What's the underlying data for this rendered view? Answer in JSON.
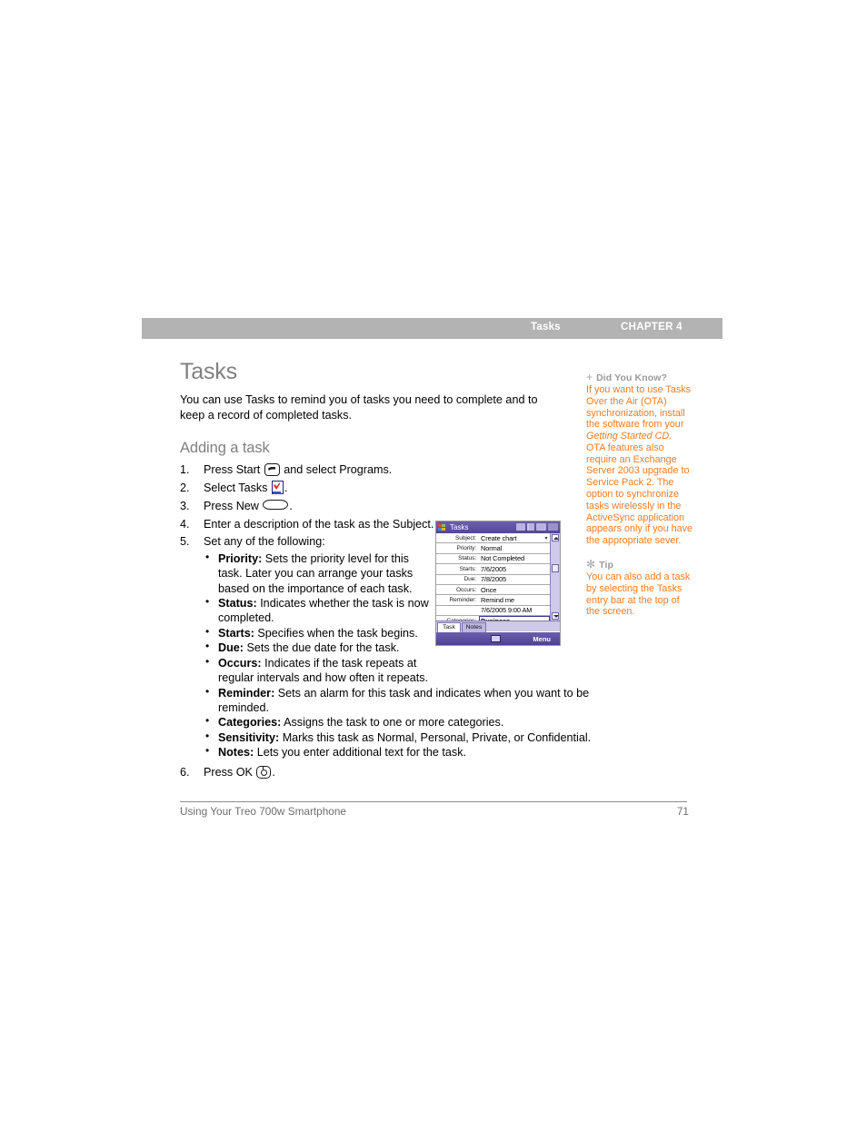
{
  "header": {
    "section": "Tasks",
    "chapter": "CHAPTER 4"
  },
  "main": {
    "title": "Tasks",
    "intro": "You can use Tasks to remind you of tasks you need to complete and to keep a record of completed tasks.",
    "subhead": "Adding a task",
    "steps": [
      {
        "num": "1.",
        "pre": "Press Start",
        "icon": "start-key-icon",
        "post": "and select Programs."
      },
      {
        "num": "2.",
        "pre": "Select Tasks",
        "icon": "tasks-app-icon",
        "post": "."
      },
      {
        "num": "3.",
        "pre": "Press New",
        "icon": "softkey-icon",
        "post": "."
      },
      {
        "num": "4.",
        "pre": "Enter a description of the task as the Subject.",
        "icon": "",
        "post": ""
      },
      {
        "num": "5.",
        "pre": "Set any of the following:",
        "icon": "",
        "post": ""
      },
      {
        "num": "6.",
        "pre": "Press OK",
        "icon": "ok-key-icon",
        "post": "."
      }
    ],
    "bullets": [
      {
        "term": "Priority:",
        "desc": "Sets the priority level for this task. Later you can arrange your tasks based on the importance of each task."
      },
      {
        "term": "Status:",
        "desc": "Indicates whether the task is now completed."
      },
      {
        "term": "Starts:",
        "desc": "Specifies when the task begins."
      },
      {
        "term": "Due:",
        "desc": "Sets the due date for the task."
      },
      {
        "term": "Occurs:",
        "desc": "Indicates if the task repeats at regular intervals and how often it repeats."
      },
      {
        "term": "Reminder:",
        "desc": "Sets an alarm for this task and indicates when you want to be reminded."
      },
      {
        "term": "Categories:",
        "desc": "Assigns the task to one or more categories."
      },
      {
        "term": "Sensitivity:",
        "desc": "Marks this task as Normal, Personal, Private, or Confidential."
      },
      {
        "term": "Notes:",
        "desc": "Lets you enter additional text for the task."
      }
    ]
  },
  "device": {
    "title": "Tasks",
    "status_icons": [
      "input-status-icon",
      "signal-icon",
      "battery-icon",
      "ok-icon"
    ],
    "fields": [
      {
        "label": "Subject:",
        "value": "Create chart",
        "caret": "▾"
      },
      {
        "label": "Priority:",
        "value": "Normal",
        "caret": ""
      },
      {
        "label": "Status:",
        "value": "Not Completed",
        "caret": ""
      },
      {
        "label": "Starts:",
        "value": "7/6/2005",
        "caret": ""
      },
      {
        "label": "Due:",
        "value": "7/8/2005",
        "caret": ""
      },
      {
        "label": "Occurs:",
        "value": "Once",
        "caret": ""
      },
      {
        "label": "Reminder:",
        "value": "Remind me",
        "caret": ""
      },
      {
        "label": "",
        "value": "7/6/2005     9:00 AM",
        "caret": ""
      },
      {
        "label": "Categories:",
        "value": "Business",
        "caret": ""
      }
    ],
    "tabs": [
      "Task",
      "Notes"
    ],
    "softkey_menu": "Menu",
    "softkey_input": "keyboard-icon"
  },
  "sidebar": {
    "did_you_know": {
      "glyph": "+",
      "heading": "Did You Know?",
      "text_1": "If you want to use Tasks Over the Air (OTA) synchronization, install the software from your ",
      "text_italic": "Getting Started CD.",
      "text_2": " OTA features also require an Exchange Server 2003 upgrade to Service Pack 2. The option to synchronize tasks wirelessly in the ActiveSync application appears only if you have the appropriate sever."
    },
    "tip": {
      "glyph": "✻",
      "heading": "Tip",
      "text": "You can also add a task by selecting the Tasks entry bar at the top of the screen."
    }
  },
  "footer": {
    "left": "Using Your Treo 700w Smartphone",
    "page": "71"
  },
  "colors": {
    "header_bar": "#b3b3b3",
    "heading_gray": "#808080",
    "sidebar_orange": "#f47b20",
    "device_purple": "#5b4f9e"
  }
}
